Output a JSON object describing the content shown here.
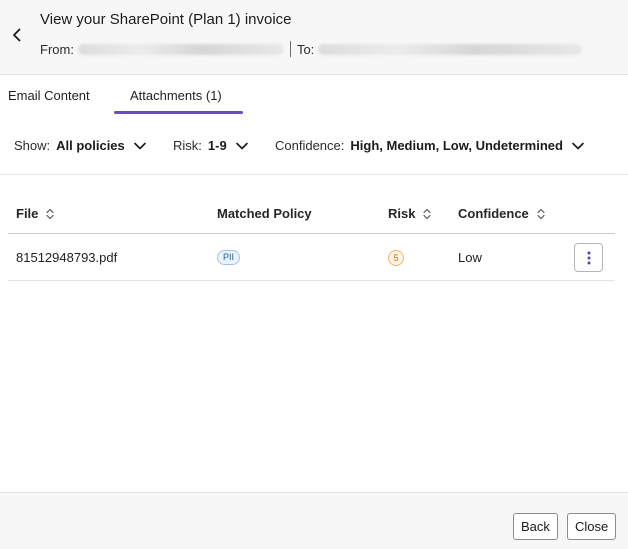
{
  "header": {
    "title": "View your SharePoint (Plan 1) invoice",
    "from_label": "From:",
    "to_label": "To:"
  },
  "tabs": [
    {
      "label": "Email Content",
      "selected": false
    },
    {
      "label": "Attachments (1)",
      "selected": true
    }
  ],
  "filters": {
    "show": {
      "label": "Show:",
      "value": "All policies"
    },
    "risk": {
      "label": "Risk:",
      "value": "1-9"
    },
    "confidence": {
      "label": "Confidence:",
      "value": "High, Medium, Low, Undetermined"
    }
  },
  "table": {
    "columns": [
      "File",
      "Matched Policy",
      "Risk",
      "Confidence"
    ],
    "rows": [
      {
        "file": "81512948793.pdf",
        "policy": "PII",
        "risk": "5",
        "confidence": "Low"
      }
    ]
  },
  "footer": {
    "back_label": "Back",
    "close_label": "Close"
  },
  "colors": {
    "accent": "#6b4cc8",
    "pill_border": "#9ec3e8",
    "risk_border": "#e8b66a"
  }
}
